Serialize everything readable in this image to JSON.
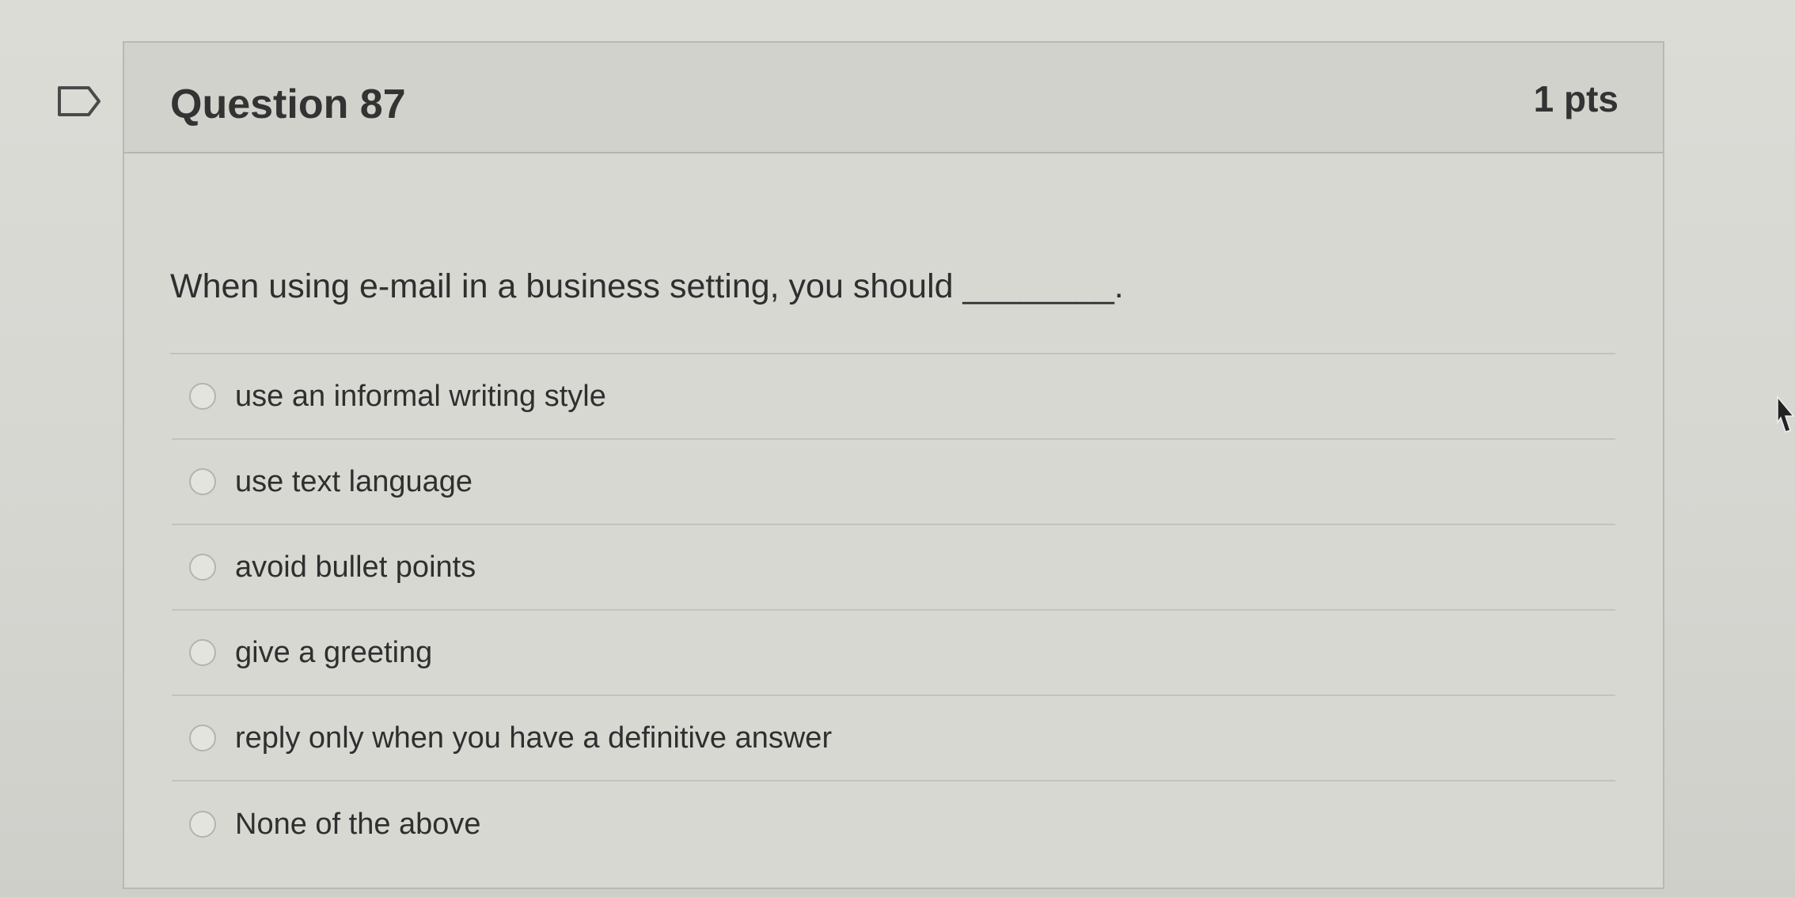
{
  "question": {
    "title": "Question 87",
    "points": "1 pts",
    "text": "When using e-mail in a business setting, you should ________.",
    "flag_icon": "flag-outline-icon"
  },
  "answers": [
    {
      "label": "use an informal writing style"
    },
    {
      "label": "use text language"
    },
    {
      "label": "avoid bullet points"
    },
    {
      "label": "give a greeting"
    },
    {
      "label": "reply only when you have a definitive answer"
    },
    {
      "label": "None of the above"
    }
  ],
  "colors": {
    "text": "#333333",
    "background": "#d8d8d3",
    "border": "#b9b9b4"
  }
}
